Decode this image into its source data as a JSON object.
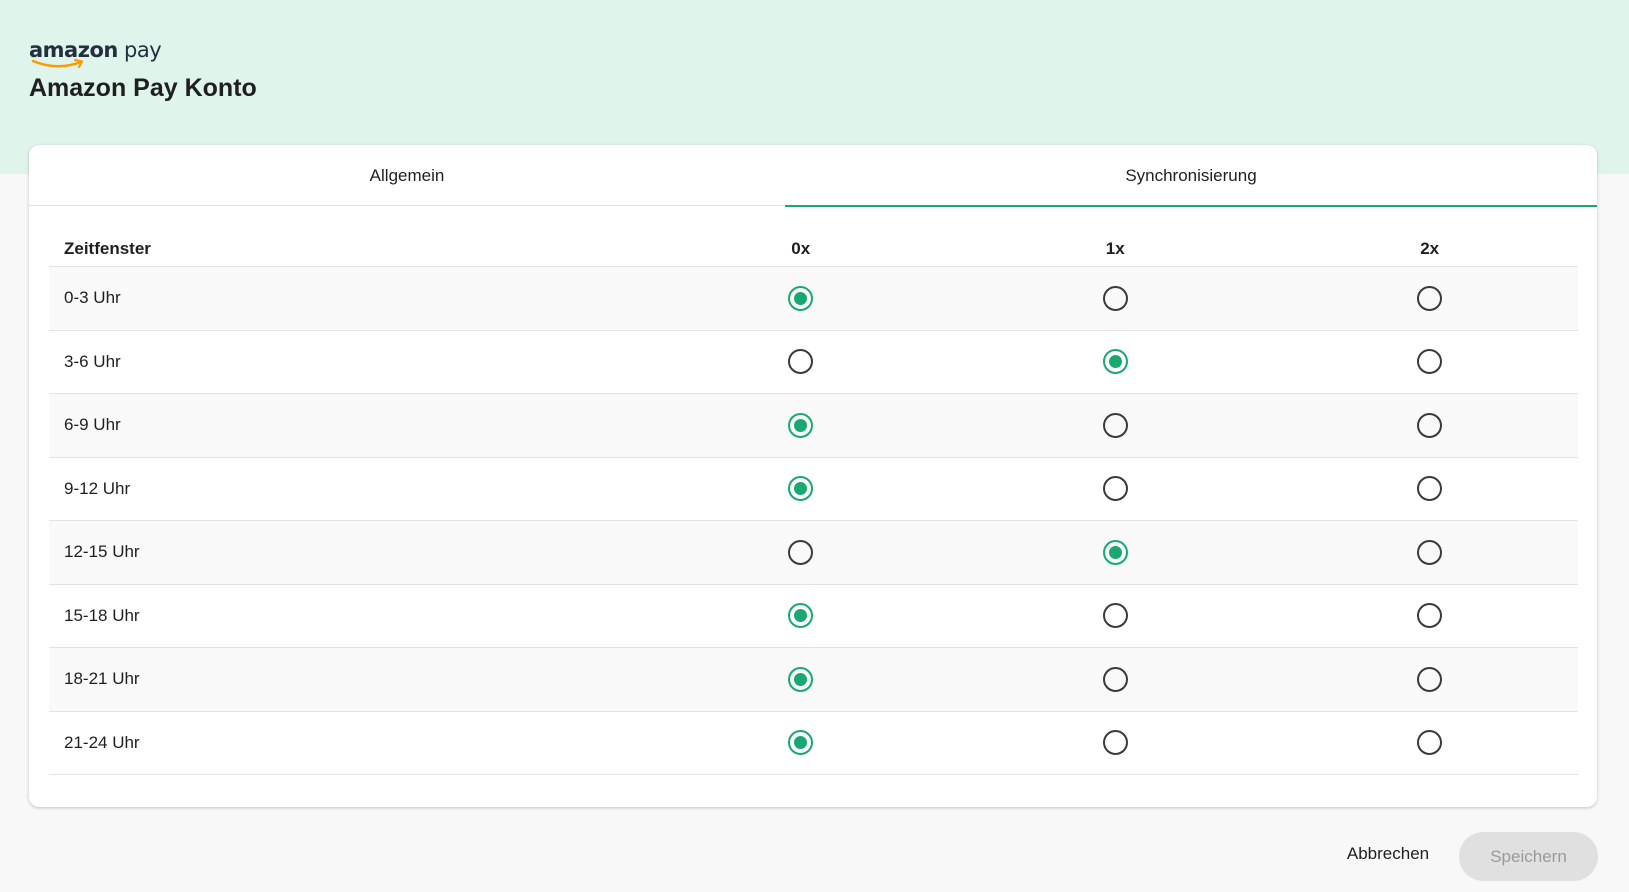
{
  "brand": {
    "logo_bold": "amazon",
    "logo_light": "pay",
    "accent": "#1aa872",
    "header_bg": "#dff4ea"
  },
  "header": {
    "title": "Amazon Pay Konto"
  },
  "tabs": [
    {
      "label": "Allgemein",
      "active": false
    },
    {
      "label": "Synchronisierung",
      "active": true
    }
  ],
  "table": {
    "columns": [
      "Zeitfenster",
      "0x",
      "1x",
      "2x"
    ],
    "rows": [
      {
        "label": "0-3 Uhr",
        "selected": "0x"
      },
      {
        "label": "3-6 Uhr",
        "selected": "1x"
      },
      {
        "label": "6-9 Uhr",
        "selected": "0x"
      },
      {
        "label": "9-12 Uhr",
        "selected": "0x"
      },
      {
        "label": "12-15 Uhr",
        "selected": "1x"
      },
      {
        "label": "15-18 Uhr",
        "selected": "0x"
      },
      {
        "label": "18-21 Uhr",
        "selected": "0x"
      },
      {
        "label": "21-24 Uhr",
        "selected": "0x"
      }
    ]
  },
  "footer": {
    "cancel_label": "Abbrechen",
    "save_label": "Speichern",
    "save_disabled": true
  }
}
